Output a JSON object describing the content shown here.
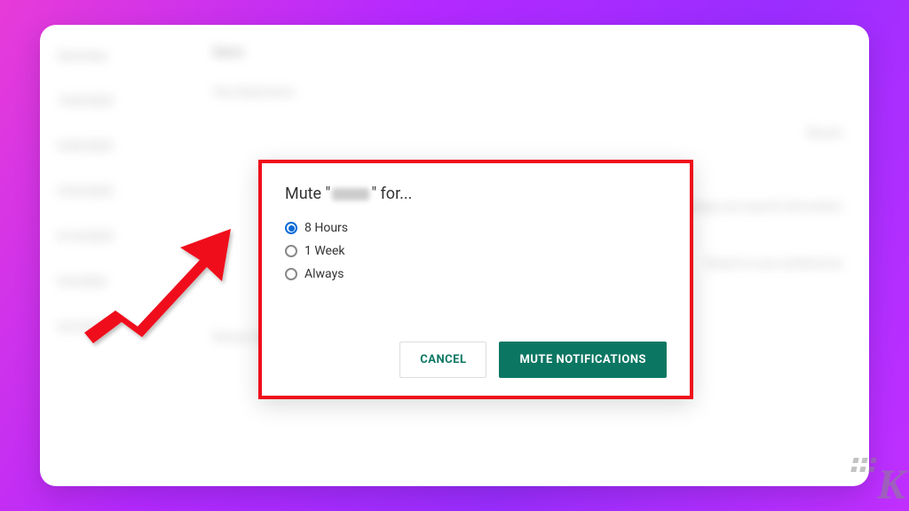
{
  "colors": {
    "accent_green": "#0b7763",
    "radio_blue": "#0a6bd6",
    "highlight_red": "#ef0e1b"
  },
  "dialog": {
    "title_prefix": "Mute \"",
    "title_suffix": "\" for...",
    "options": [
      {
        "label": "8 Hours",
        "selected": true
      },
      {
        "label": "1 Week",
        "selected": false
      },
      {
        "label": "Always",
        "selected": false
      }
    ],
    "cancel_label": "CANCEL",
    "confirm_label": "MUTE NOTIFICATIONS"
  },
  "watermark": {
    "letter": "K"
  }
}
